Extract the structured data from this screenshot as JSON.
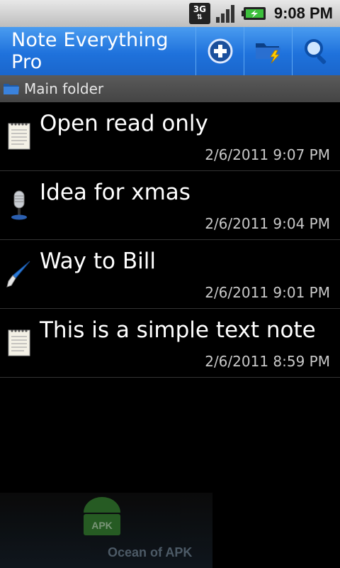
{
  "status": {
    "network": "3G",
    "time": "9:08 PM"
  },
  "actionbar": {
    "title": "Note Everything Pro",
    "icons": [
      "add-icon",
      "folder-lightning-icon",
      "search-icon"
    ]
  },
  "folder": {
    "label": "Main folder"
  },
  "notes": [
    {
      "title": "Open read only",
      "date": "2/6/2011 9:07 PM",
      "icon": "text-note-icon"
    },
    {
      "title": "Idea for xmas",
      "date": "2/6/2011 9:04 PM",
      "icon": "microphone-icon"
    },
    {
      "title": "Way to Bill",
      "date": "2/6/2011 9:01 PM",
      "icon": "paintbrush-icon"
    },
    {
      "title": "This is a simple text note",
      "date": "2/6/2011 8:59 PM",
      "icon": "text-note-icon"
    }
  ],
  "watermark": {
    "text": "Ocean of APK",
    "badge": "APK"
  },
  "colors": {
    "actionbar": "#1f72dc",
    "folderbar": "#4e4e4e",
    "background": "#000000"
  }
}
